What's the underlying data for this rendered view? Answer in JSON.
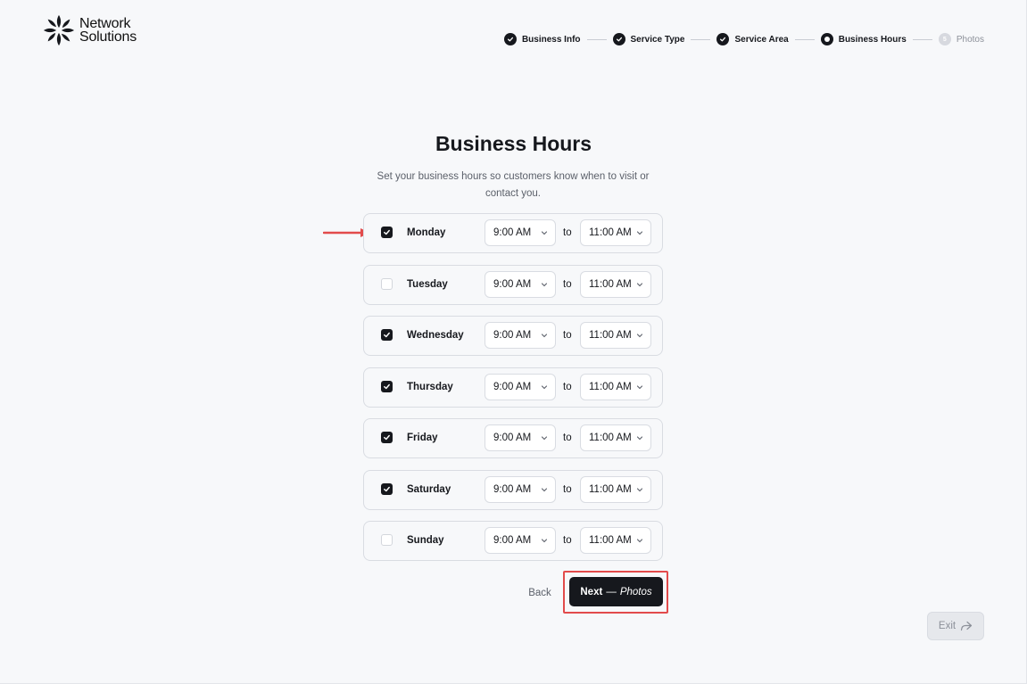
{
  "brand": {
    "line1": "Network",
    "line2": "Solutions",
    "logo_icon": "network-solutions-logo-icon"
  },
  "stepper": {
    "steps": [
      {
        "label": "Business Info",
        "state": "done"
      },
      {
        "label": "Service Type",
        "state": "done"
      },
      {
        "label": "Service Area",
        "state": "done"
      },
      {
        "label": "Business Hours",
        "state": "current"
      },
      {
        "label": "Photos",
        "state": "future",
        "number": "5"
      }
    ]
  },
  "page": {
    "title": "Business Hours",
    "subtitle": "Set your business hours so customers know when to visit or contact you."
  },
  "hours": {
    "to_label": "to",
    "days": [
      {
        "name": "Monday",
        "checked": true,
        "start": "9:00 AM",
        "end": "11:00 AM"
      },
      {
        "name": "Tuesday",
        "checked": false,
        "start": "9:00 AM",
        "end": "11:00 AM"
      },
      {
        "name": "Wednesday",
        "checked": true,
        "start": "9:00 AM",
        "end": "11:00 AM"
      },
      {
        "name": "Thursday",
        "checked": true,
        "start": "9:00 AM",
        "end": "11:00 AM"
      },
      {
        "name": "Friday",
        "checked": true,
        "start": "9:00 AM",
        "end": "11:00 AM"
      },
      {
        "name": "Saturday",
        "checked": true,
        "start": "9:00 AM",
        "end": "11:00 AM"
      },
      {
        "name": "Sunday",
        "checked": false,
        "start": "9:00 AM",
        "end": "11:00 AM"
      }
    ]
  },
  "actions": {
    "back_label": "Back",
    "next_label": "Next",
    "next_dash": "—",
    "next_target": "Photos",
    "exit_label": "Exit"
  },
  "colors": {
    "accent": "#16181d",
    "highlight": "#e24b4b",
    "background": "#f7f8fa"
  }
}
